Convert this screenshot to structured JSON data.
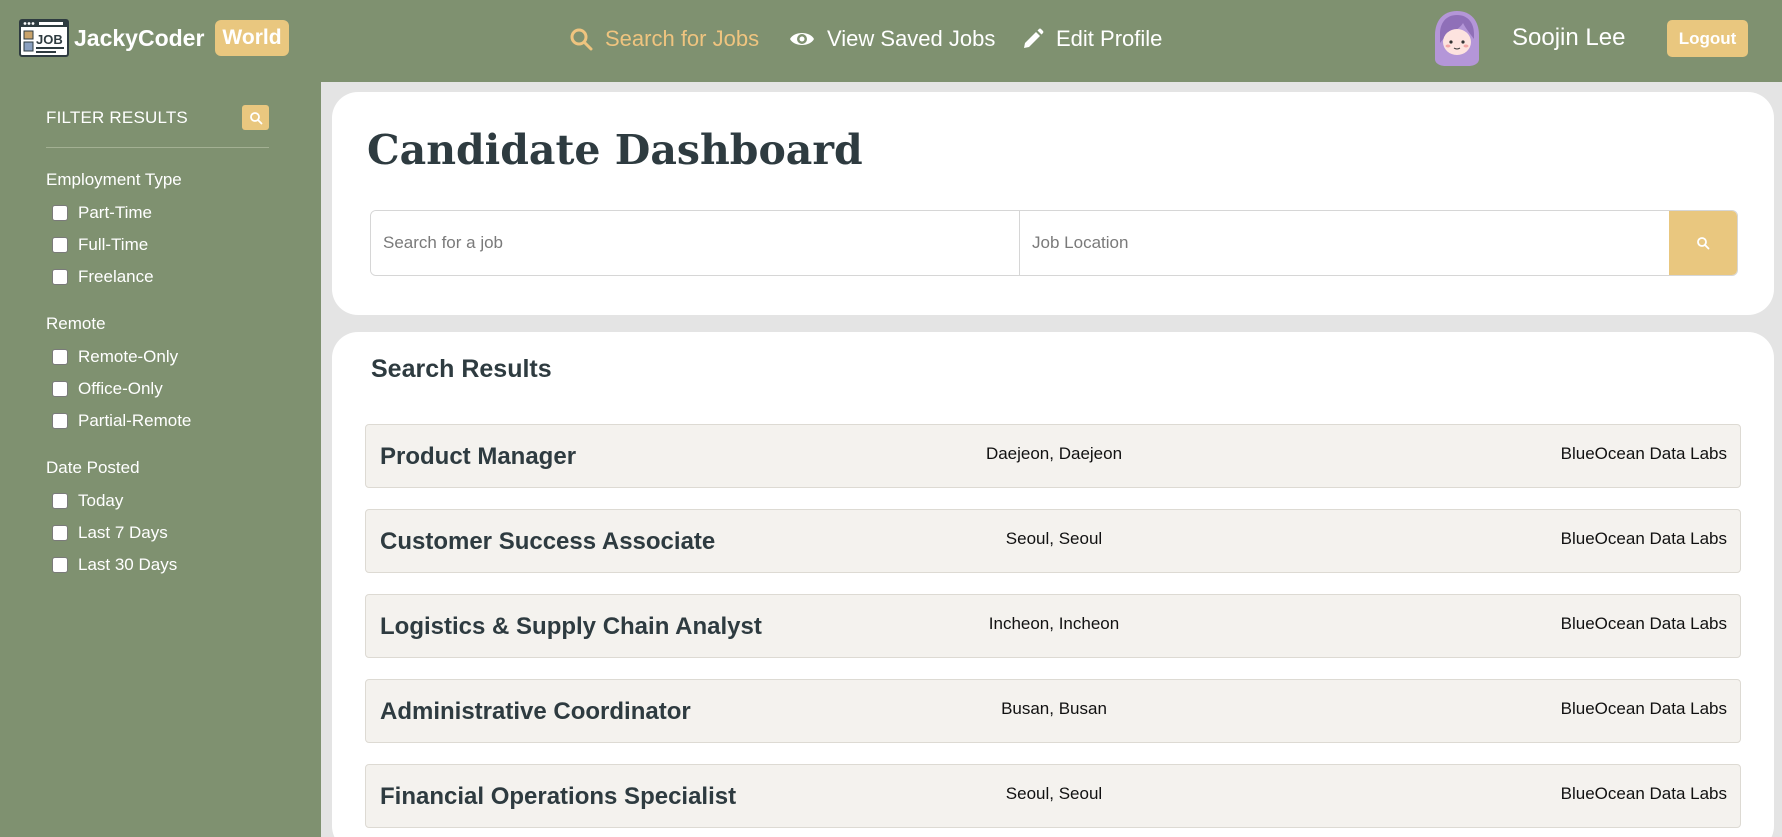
{
  "brand": {
    "name": "JackyCoder",
    "badge": "World"
  },
  "nav": {
    "search_jobs": "Search for Jobs",
    "saved_jobs": "View Saved Jobs",
    "edit_profile": "Edit Profile"
  },
  "user": {
    "name": "Soojin Lee",
    "logout_label": "Logout"
  },
  "sidebar": {
    "title": "FILTER RESULTS",
    "groups": [
      {
        "title": "Employment Type",
        "options": [
          "Part-Time",
          "Full-Time",
          "Freelance"
        ]
      },
      {
        "title": "Remote",
        "options": [
          "Remote-Only",
          "Office-Only",
          "Partial-Remote"
        ]
      },
      {
        "title": "Date Posted",
        "options": [
          "Today",
          "Last 7 Days",
          "Last 30 Days"
        ]
      }
    ]
  },
  "dashboard": {
    "title": "Candidate Dashboard",
    "job_placeholder": "Search for a job",
    "location_placeholder": "Job Location"
  },
  "results": {
    "title": "Search Results",
    "jobs": [
      {
        "title": "Product Manager",
        "location": "Daejeon, Daejeon",
        "company": "BlueOcean Data Labs"
      },
      {
        "title": "Customer Success Associate",
        "location": "Seoul, Seoul",
        "company": "BlueOcean Data Labs"
      },
      {
        "title": "Logistics & Supply Chain Analyst",
        "location": "Incheon, Incheon",
        "company": "BlueOcean Data Labs"
      },
      {
        "title": "Administrative Coordinator",
        "location": "Busan, Busan",
        "company": "BlueOcean Data Labs"
      },
      {
        "title": "Financial Operations Specialist",
        "location": "Seoul, Seoul",
        "company": "BlueOcean Data Labs"
      }
    ]
  },
  "colors": {
    "header_bg": "#7f9170",
    "accent": "#e9c77f",
    "active_nav": "#efc47f",
    "text_dark": "#2e3b40"
  }
}
